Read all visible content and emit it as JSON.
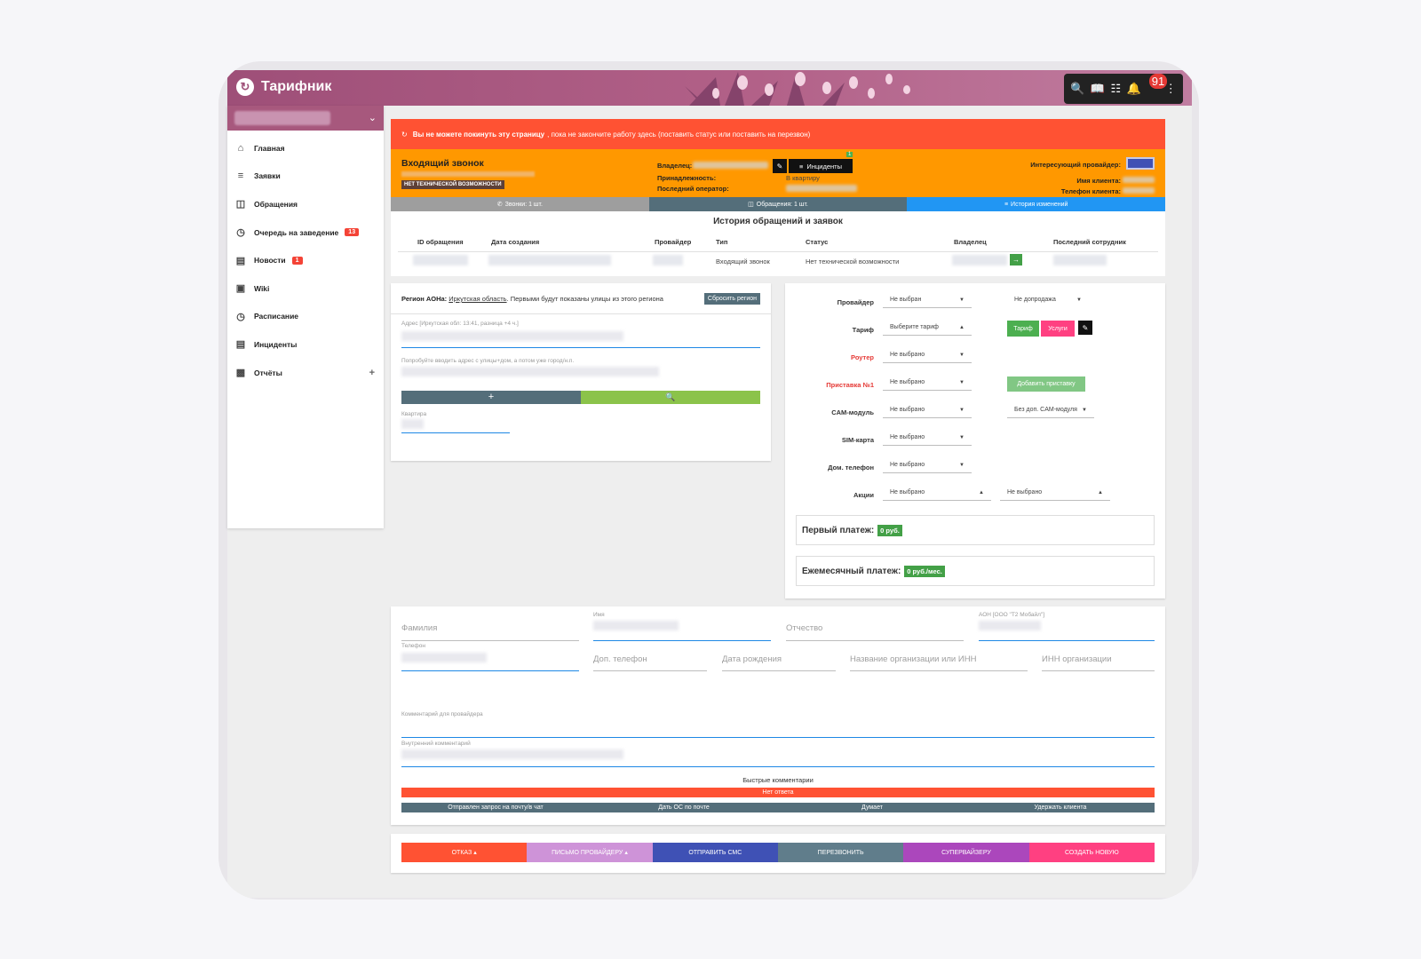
{
  "app": {
    "title": "Тарифник"
  },
  "header": {
    "notifications_count": "91",
    "icons": [
      "search-icon",
      "book-icon",
      "sitemap-icon",
      "bell-icon",
      "more-vert-icon"
    ]
  },
  "sidebar": {
    "items": [
      {
        "label": "Главная",
        "icon": "home-icon"
      },
      {
        "label": "Заявки",
        "icon": "list-icon"
      },
      {
        "label": "Обращения",
        "icon": "contact-card-icon"
      },
      {
        "label": "Очередь на заведение",
        "icon": "alarm-icon",
        "badge": "13"
      },
      {
        "label": "Новости",
        "icon": "news-icon",
        "badge": "1"
      },
      {
        "label": "Wiki",
        "icon": "box-icon"
      },
      {
        "label": "Расписание",
        "icon": "clock-icon"
      },
      {
        "label": "Инциденты",
        "icon": "message-icon"
      },
      {
        "label": "Отчёты",
        "icon": "chart-icon"
      }
    ]
  },
  "alert": {
    "bold": "Вы не можете покинуть эту страницу",
    "rest": ", пока не закончите работу здесь (поставить статус или поставить на перезвон)"
  },
  "call": {
    "title": "Входящий звонок",
    "tag": "НЕТ ТЕХНИЧЕСКОЙ ВОЗМОЖНОСТИ",
    "owner_label": "Владелец:",
    "belonging_label": "Принадлежность:",
    "belonging_value": "В квартиру",
    "last_operator_label": "Последний оператор:",
    "incidents_label": "Инциденты",
    "incidents_badge": "1",
    "interested_provider_label": "Интересующий провайдер:",
    "client_name_label": "Имя клиента:",
    "client_phone_label": "Телефон клиента:"
  },
  "tabs": [
    {
      "label": "Звонки: 1 шт.",
      "color": "#9e9e9e",
      "icon": "phone-icon"
    },
    {
      "label": "Обращения: 1 шт.",
      "color": "#546e7a",
      "icon": "contact-card-icon"
    },
    {
      "label": "История изменений",
      "color": "#2196f3",
      "icon": "list-icon"
    }
  ],
  "history": {
    "title": "История обращений и заявок",
    "columns": [
      "ID обращения",
      "Дата создания",
      "Провайдер",
      "Тип",
      "Статус",
      "Владелец",
      "Последний сотрудник"
    ],
    "row": {
      "type": "Входящий звонок",
      "status": "Нет технической возможности"
    }
  },
  "address": {
    "region_label": "Регион АОНа:",
    "region_value": "Иркутская область",
    "region_note": ". Первыми будут показаны улицы из этого региона",
    "reset_label": "Сбросить регион",
    "address_label": "Адрес [Иркутская обл: 13:41, разница +4 ч.]",
    "hint_label": "Попробуйте вводить адрес с улицы+дом, а потом уже город/н.п.",
    "add_label": "+",
    "apartment_label": "Квартира"
  },
  "selection": {
    "provider_label": "Провайдер",
    "provider_value": "Не выбран",
    "extra_value": "Не допродажа",
    "tariff_label": "Тариф",
    "tariff_value": "Выберите тариф",
    "tariff_btn": "Тариф",
    "services_btn": "Услуги",
    "router_label": "Роутер",
    "router_value": "Не выбрано",
    "stb_label": "Приставка №1",
    "stb_value": "Не выбрано",
    "add_stb_btn": "Добавить приставку",
    "cam_label": "CAM-модуль",
    "cam_value": "Не выбрано",
    "cam_extra": "Без доп. CAM-модуля",
    "sim_label": "SIM-карта",
    "sim_value": "Не выбрано",
    "home_phone_label": "Дом. телефон",
    "home_phone_value": "Не выбрано",
    "promo_label": "Акции",
    "promo_value1": "Не выбрано",
    "promo_value2": "Не выбрано",
    "first_payment_label": "Первый платеж:",
    "first_payment_value": "0 руб.",
    "monthly_payment_label": "Ежемесячный платеж:",
    "monthly_payment_value": "0 руб./мес."
  },
  "person": {
    "surname": "Фамилия",
    "name_label": "Имя",
    "patronymic": "Отчество",
    "aon_label": "АОН [ООО \"Т2 Мобайл\"]",
    "phone_label": "Телефон",
    "extra_phone": "Доп. телефон",
    "birthdate": "Дата рождения",
    "org": "Название организации или ИНН",
    "org_inn": "ИНН организации",
    "provider_comment": "Комментарий для провайдера",
    "internal_comment": "Внутренний комментарий",
    "quick_title": "Быстрые комментарии",
    "no_answer": "Нет ответа",
    "quick": [
      "Отправлен запрос на почту/в чат",
      "Дать ОС по почте",
      "Думает",
      "Удержать клиента"
    ]
  },
  "actions": [
    {
      "label": "ОТКАЗ",
      "color": "#ff5233",
      "caret": "▴"
    },
    {
      "label": "ПИСЬМО ПРОВАЙДЕРУ",
      "color": "#ce93d8",
      "caret": "▴"
    },
    {
      "label": "ОТПРАВИТЬ СМС",
      "color": "#3f51b5",
      "caret": ""
    },
    {
      "label": "ПЕРЕЗВОНИТЬ",
      "color": "#607d8b",
      "caret": ""
    },
    {
      "label": "СУПЕРВАЙЗЕРУ",
      "color": "#ab47bc",
      "caret": ""
    },
    {
      "label": "СОЗДАТЬ НОВУЮ",
      "color": "#ff4081",
      "caret": ""
    }
  ]
}
